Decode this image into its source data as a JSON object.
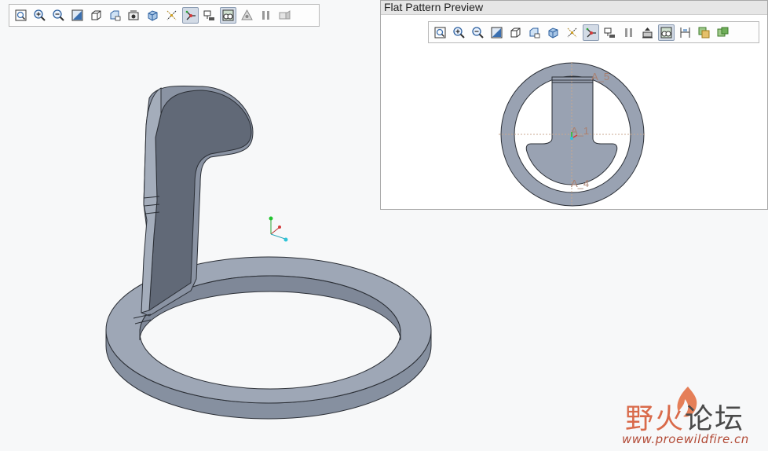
{
  "main_toolbar": {
    "icons": [
      "refit-icon",
      "zoom-in-icon",
      "zoom-out-icon",
      "repaint-icon",
      "view-orientation-icon",
      "saved-views-icon",
      "view-manager-icon",
      "display-style-icon",
      "datum-display-icon",
      "spin-center-icon",
      "annotation-display-icon",
      "appearance-icon",
      "sheetmetal-highlight-icon",
      "pause-icon",
      "flat-pattern-icon"
    ],
    "active": [
      "spin-center-icon",
      "appearance-icon"
    ]
  },
  "preview_panel": {
    "title": "Flat Pattern Preview",
    "toolbar": {
      "icons": [
        "refit-icon",
        "zoom-in-icon",
        "zoom-out-icon",
        "repaint-icon",
        "view-orientation-icon",
        "saved-views-icon",
        "display-style-icon",
        "datum-display-icon",
        "spin-center-icon",
        "annotation-display-icon",
        "pause-icon",
        "lock-orientation-icon",
        "appearance-icon",
        "dimension-icon",
        "export-icon",
        "copy-icon"
      ],
      "active": [
        "spin-center-icon",
        "appearance-icon"
      ]
    },
    "datum_labels": [
      "A_5",
      "A_1",
      "A_4"
    ]
  },
  "watermark": {
    "title_a": "野火",
    "title_b": "论坛",
    "url": "www.proewildfire.cn"
  },
  "colors": {
    "model_face": "#99a2b2",
    "model_dark": "#5a6270",
    "datum_axis": "#c8a890",
    "accent": "#d96a4a"
  }
}
